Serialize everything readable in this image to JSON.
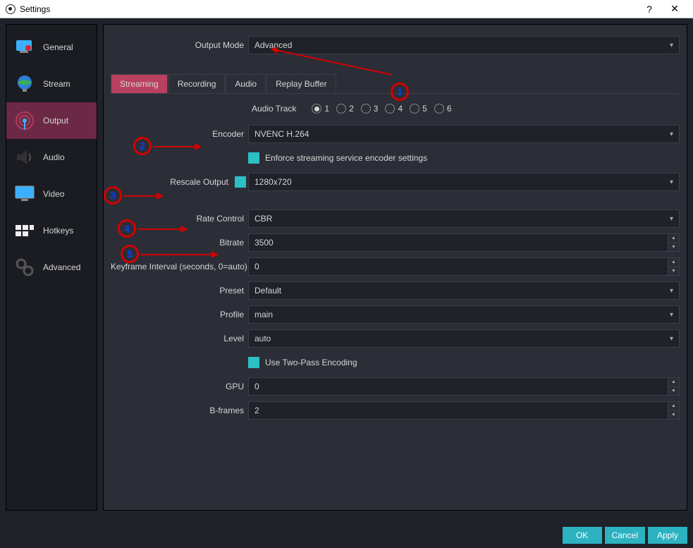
{
  "titlebar": {
    "title": "Settings",
    "help": "?",
    "close": "✕"
  },
  "sidebar": {
    "items": [
      {
        "label": "General"
      },
      {
        "label": "Stream"
      },
      {
        "label": "Output"
      },
      {
        "label": "Audio"
      },
      {
        "label": "Video"
      },
      {
        "label": "Hotkeys"
      },
      {
        "label": "Advanced"
      }
    ],
    "active_index": 2
  },
  "output_mode": {
    "label": "Output Mode",
    "value": "Advanced"
  },
  "tabs": [
    "Streaming",
    "Recording",
    "Audio",
    "Replay Buffer"
  ],
  "active_tab": 0,
  "audio_track": {
    "label": "Audio Track",
    "options": [
      "1",
      "2",
      "3",
      "4",
      "5",
      "6"
    ],
    "selected": 0
  },
  "form": {
    "encoder": {
      "label": "Encoder",
      "value": "NVENC H.264"
    },
    "enforce": {
      "label": "Enforce streaming service encoder settings",
      "checked": true
    },
    "rescale": {
      "label": "Rescale Output",
      "checked": true,
      "value": "1280x720"
    },
    "rate_control": {
      "label": "Rate Control",
      "value": "CBR"
    },
    "bitrate": {
      "label": "Bitrate",
      "value": "3500"
    },
    "keyframe": {
      "label": "Keyframe Interval (seconds, 0=auto)",
      "value": "0"
    },
    "preset": {
      "label": "Preset",
      "value": "Default"
    },
    "profile": {
      "label": "Profile",
      "value": "main"
    },
    "level": {
      "label": "Level",
      "value": "auto"
    },
    "two_pass": {
      "label": "Use Two-Pass Encoding",
      "checked": true
    },
    "gpu": {
      "label": "GPU",
      "value": "0"
    },
    "bframes": {
      "label": "B-frames",
      "value": "2"
    }
  },
  "footer": {
    "ok": "OK",
    "cancel": "Cancel",
    "apply": "Apply"
  },
  "annotations": [
    "1",
    "2",
    "3",
    "4",
    "5"
  ]
}
